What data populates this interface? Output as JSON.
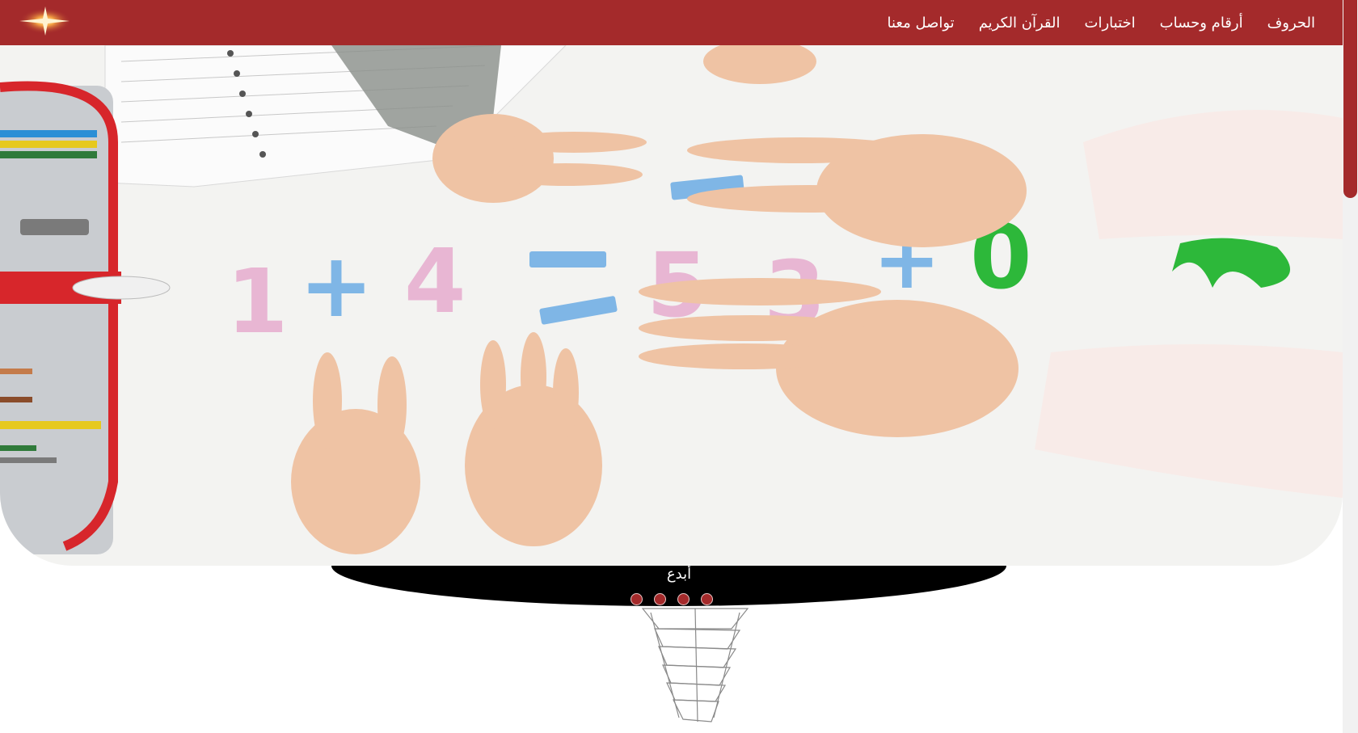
{
  "navbar": {
    "logo_icon": "sparkle-star-icon",
    "items": [
      {
        "label": "الحروف"
      },
      {
        "label": "أرقام وحساب"
      },
      {
        "label": "اختبارات"
      },
      {
        "label": "القرآن الكريم"
      },
      {
        "label": "تواصل معنا"
      }
    ]
  },
  "slider": {
    "caption": "أبدع",
    "slide_count": 4,
    "active_slide": 1
  },
  "colors": {
    "brand": "#a42a2b",
    "caption_band": "#000000",
    "background": "#ffffff"
  }
}
